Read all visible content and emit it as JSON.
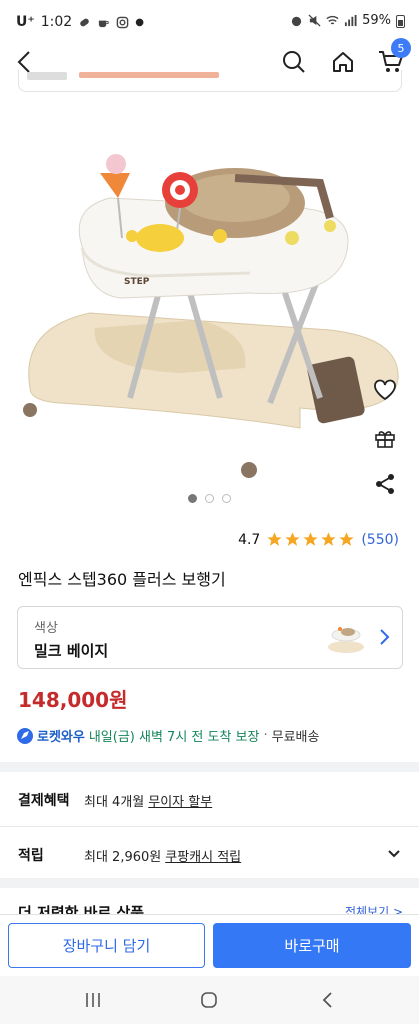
{
  "status_bar": {
    "carrier": "U⁺",
    "time": "1:02",
    "battery": "59%"
  },
  "nav": {
    "cart_count": "5"
  },
  "product": {
    "rating": "4.7",
    "review_count": "(550)",
    "title": "엔픽스 스텝360 플러스 보행기",
    "option_label": "색상",
    "option_value": "밀크 베이지",
    "price": "148,000원",
    "brand_on_image": "STEP"
  },
  "delivery": {
    "badge": "로켓와우",
    "arrival": "내일(금) 새벽 7시 전 도착 보장",
    "separator": "·",
    "shipping": "무료배송"
  },
  "benefits": [
    {
      "title": "결제혜택",
      "prefix": "최대 4개월",
      "link": "무이자 할부"
    },
    {
      "title": "적립",
      "prefix": "최대 2,960원",
      "link": "쿠팡캐시 적립"
    }
  ],
  "peek_section": {
    "title": "더 저렴한 바로 상품",
    "more": "전체보기 >"
  },
  "buttons": {
    "add_to_cart": "장바구니 담기",
    "buy_now": "바로구매"
  },
  "colors": {
    "accent": "#3578f6",
    "price": "#c62b2b",
    "star": "#f5a623",
    "link": "#3365d6"
  }
}
